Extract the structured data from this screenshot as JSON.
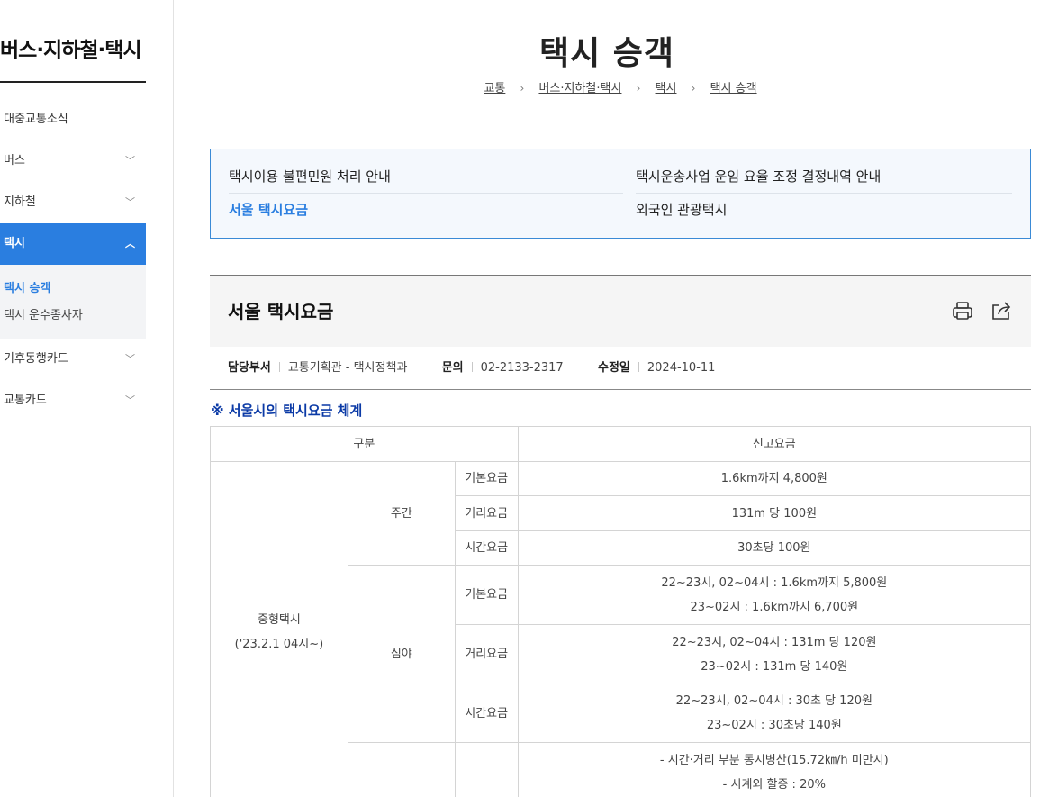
{
  "sidebar": {
    "title": "버스·지하철·택시",
    "items": [
      {
        "label": "대중교통소식",
        "chevron": ""
      },
      {
        "label": "버스",
        "chevron": "﹀"
      },
      {
        "label": "지하철",
        "chevron": "﹀"
      },
      {
        "label": "택시",
        "chevron": "︿"
      }
    ],
    "sub_items": [
      "택시 승객",
      "택시 운수종사자"
    ],
    "items_after": [
      {
        "label": "기후동행카드",
        "chevron": "﹀"
      },
      {
        "label": "교통카드",
        "chevron": "﹀"
      }
    ]
  },
  "header": {
    "title": "택시 승객",
    "breadcrumb": [
      "교통",
      "버스·지하철·택시",
      "택시",
      "택시 승객"
    ],
    "breadcrumb_sep": "›"
  },
  "related_links": {
    "col1": [
      "택시이용 불편민원 처리 안내",
      "서울 택시요금"
    ],
    "col2": [
      "택시운송사업 운임 요율 조정 결정내역 안내",
      "외국인 관광택시"
    ]
  },
  "content": {
    "title": "서울 택시요금",
    "print_icon": "print-icon",
    "share_icon": "share-icon",
    "meta": {
      "dept_label": "담당부서",
      "dept_value": "교통기획관 - 택시정책과",
      "contact_label": "문의",
      "contact_value": "02-2133-2317",
      "modified_label": "수정일",
      "modified_value": "2024-10-11"
    },
    "note": "※ 서울시의 택시요금 체계"
  },
  "fare_table": {
    "headers": {
      "category": "구분",
      "fare": "신고요금"
    },
    "taxi_type": "중형택시",
    "taxi_since": "('23.2.1 04시~)",
    "day_label": "주간",
    "night_label": "심야",
    "rows": {
      "day_base": {
        "label": "기본요금",
        "value": "1.6km까지 4,800원"
      },
      "day_distance": {
        "label": "거리요금",
        "value": "131m 당 100원"
      },
      "day_time": {
        "label": "시간요금",
        "value": "30초당 100원"
      },
      "night_base": {
        "label": "기본요금",
        "line1": "22~23시, 02~04시 : 1.6km까지 5,800원",
        "line2": "23~02시 : 1.6km까지 6,700원"
      },
      "night_distance": {
        "label": "거리요금",
        "line1": "22~23시, 02~04시 : 131m 당 120원",
        "line2": "23~02시 : 131m 당 140원"
      },
      "night_time": {
        "label": "시간요금",
        "line1": "22~23시, 02~04시 : 30초 당 120원",
        "line2": "23~02시 : 30초당 140원"
      },
      "extra": {
        "line1": "- 시간·거리 부분 동시병산(15.72㎞/h 미만시)",
        "line2": "- 시계외 할증 : 20%"
      }
    }
  },
  "colors": {
    "accent": "#2a7ee0",
    "note": "#0b3aa6",
    "box_border": "#3a8ad6",
    "box_bg": "#f4f8fd"
  }
}
